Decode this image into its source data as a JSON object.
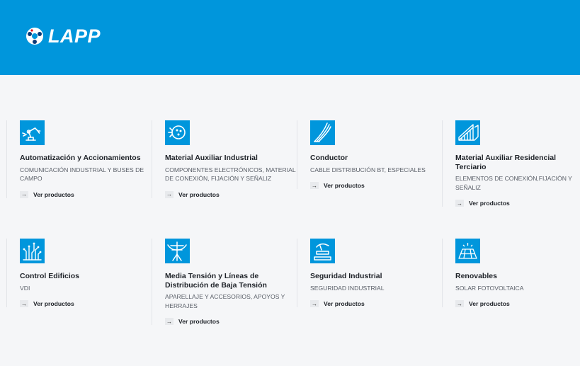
{
  "header": {
    "brand": "LAPP",
    "logo_icon": "lapp-ball-logo",
    "bg_color": "#0096dc"
  },
  "categories": [
    {
      "title": "Automatización y Accionamientos",
      "desc": "COMUNICACIÓN INDUSTRIAL Y BUSES DE CAMPO",
      "link": "Ver productos",
      "icon": "robot-arm-icon"
    },
    {
      "title": "Material Auxiliar Industrial",
      "desc": "COMPONENTES ELECTRÓNICOS, MATERIAL DE CONEXIÓN, FIJACIÓN Y SEÑALIZ",
      "link": "Ver productos",
      "icon": "connector-plug-icon"
    },
    {
      "title": "Conductor",
      "desc": "CABLE DISTRIBUCIÓN BT, ESPECIALES",
      "link": "Ver productos",
      "icon": "cable-strands-icon"
    },
    {
      "title": "Material Auxiliar Residencial Terciario",
      "desc": "ELEMENTOS DE CONEXIÓN,FIJACIÓN Y SEÑALIZ",
      "link": "Ver productos",
      "icon": "cable-tray-icon"
    },
    {
      "title": "Control Edificios",
      "desc": "VDI",
      "link": "Ver productos",
      "icon": "circuit-icon"
    },
    {
      "title": "Media Tensión y Líneas de Distribución de Baja Tensión",
      "desc": "APARELLAJE Y ACCESORIOS, APOYOS Y HERRAJES",
      "link": "Ver productos",
      "icon": "power-pole-icon"
    },
    {
      "title": "Seguridad Industrial",
      "desc": "SEGURIDAD INDUSTRIAL",
      "link": "Ver productos",
      "icon": "hand-press-icon"
    },
    {
      "title": "Renovables",
      "desc": "SOLAR FOTOVOLTAICA",
      "link": "Ver productos",
      "icon": "solar-panel-icon"
    }
  ]
}
